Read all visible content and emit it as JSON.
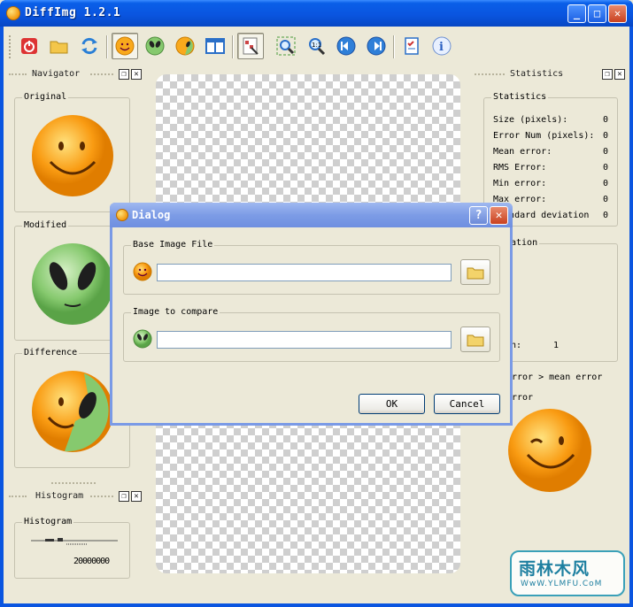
{
  "window": {
    "title": "DiffImg 1.2.1",
    "minimize": "_",
    "maximize": "□",
    "close": "✕"
  },
  "toolbar": {
    "tools": [
      "close-app-icon",
      "open-folder-icon",
      "refresh-icon",
      "original-smiley-icon",
      "modified-alien-icon",
      "difference-icon",
      "split-view-icon",
      "mask-icon",
      "fit-zoom-icon",
      "zoom-1to1-icon",
      "previous-icon",
      "next-icon",
      "preferences-icon",
      "about-icon"
    ]
  },
  "navigator": {
    "title": "Navigator",
    "original_label": "Original",
    "modified_label": "Modified",
    "difference_label": "Difference"
  },
  "histogram": {
    "title": "Histogram",
    "group_label": "Histogram",
    "axis_text": "20000000"
  },
  "statistics": {
    "title": "Statistics",
    "group_label": "Statistics",
    "rows": [
      {
        "label": "Size (pixels):",
        "value": "0"
      },
      {
        "label": "Error Num (pixels):",
        "value": "0"
      },
      {
        "label": "Mean error:",
        "value": "0"
      },
      {
        "label": "RMS Error:",
        "value": "0"
      },
      {
        "label": "Min error:",
        "value": "0"
      },
      {
        "label": "Max error:",
        "value": "0"
      },
      {
        "label": "Standard deviation",
        "value": "0"
      }
    ],
    "section2_label": "ation",
    "row_partial": "n:",
    "row_partial_value": "1",
    "error_line1": "rror > mean error",
    "error_line2": "rror"
  },
  "dialog": {
    "title": "Dialog",
    "help": "?",
    "close": "✕",
    "base_label": "Base Image File",
    "base_value": "",
    "compare_label": "Image to compare",
    "compare_value": "",
    "ok": "OK",
    "cancel": "Cancel"
  },
  "watermark": {
    "main": "雨林木风",
    "url": "WwW.YLMFU.CoM"
  }
}
